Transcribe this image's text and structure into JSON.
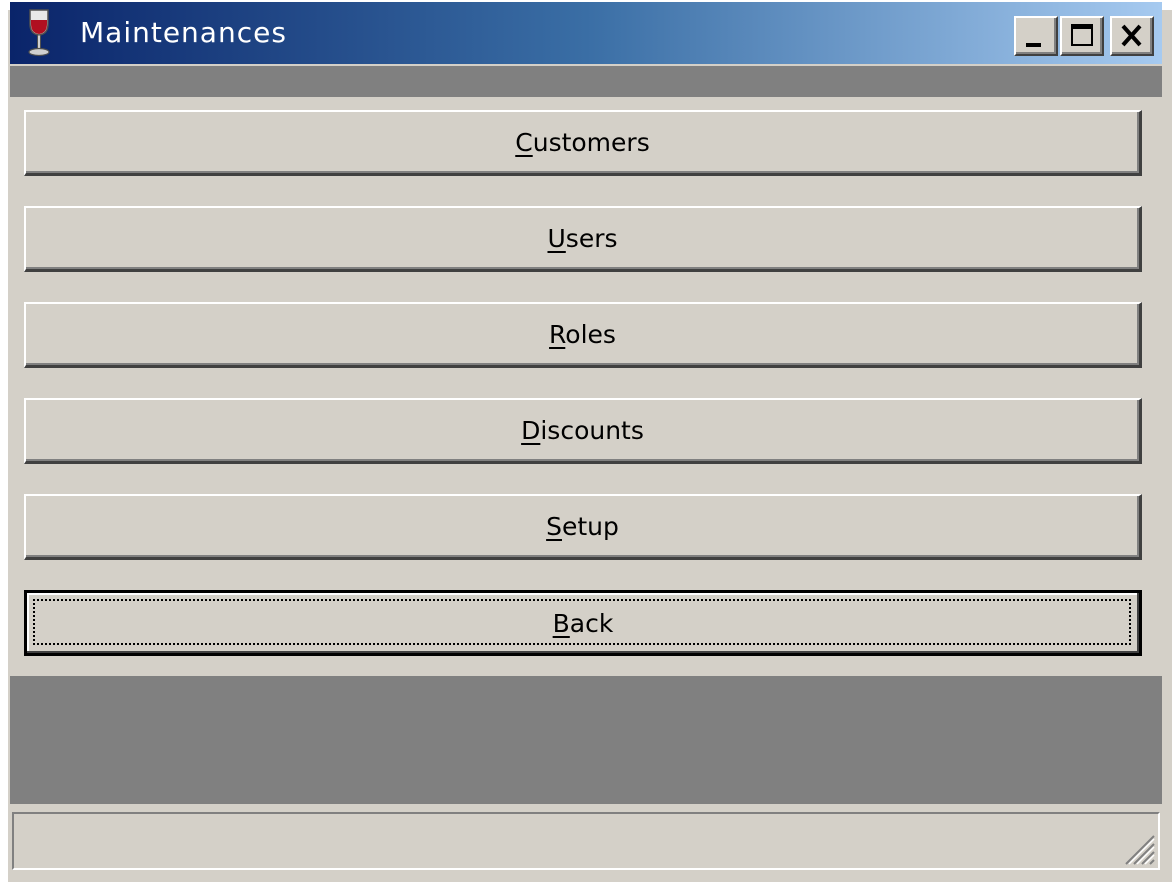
{
  "window": {
    "title": "Maintenances",
    "icon": "wine-glass-icon",
    "controls": [
      "minimize-icon",
      "maximize-icon",
      "close-icon"
    ]
  },
  "menu_buttons": [
    {
      "prefix": "",
      "mnemonic": "C",
      "rest": "ustomers",
      "label": "Customers",
      "default": false
    },
    {
      "prefix": "",
      "mnemonic": "U",
      "rest": "sers",
      "label": "Users",
      "default": false
    },
    {
      "prefix": "",
      "mnemonic": "R",
      "rest": "oles",
      "label": "Roles",
      "default": false
    },
    {
      "prefix": "",
      "mnemonic": "D",
      "rest": "iscounts",
      "label": "Discounts",
      "default": false
    },
    {
      "prefix": "",
      "mnemonic": "S",
      "rest": "etup",
      "label": "Setup",
      "default": false
    },
    {
      "prefix": "",
      "mnemonic": "B",
      "rest": "ack",
      "label": "Back",
      "default": true
    }
  ],
  "status_bar": {
    "text": ""
  },
  "colors": {
    "face": "#d4d0c8",
    "dark_strip": "#808080",
    "title_gradient_start": "#0a246a",
    "title_gradient_end": "#a6caf0"
  }
}
